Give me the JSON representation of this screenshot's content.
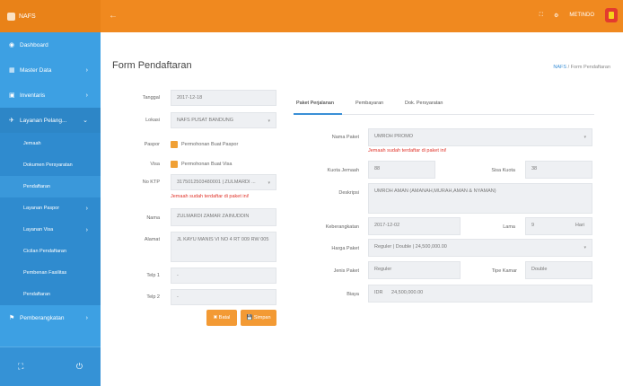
{
  "app": {
    "name": "NAFS"
  },
  "topbar": {
    "user": "METINDO"
  },
  "sidebar": {
    "items": [
      {
        "label": "Dashboard"
      },
      {
        "label": "Master Data"
      },
      {
        "label": "Inventaris"
      },
      {
        "label": "Layanan Pelang..."
      }
    ],
    "subitems": [
      {
        "label": "Jemaah"
      },
      {
        "label": "Dokumen Persyaratan"
      },
      {
        "label": "Pendaftaran"
      },
      {
        "label": "Layanan Paspor"
      },
      {
        "label": "Layanan Visa"
      },
      {
        "label": "Cicilan Pendaftaran"
      },
      {
        "label": "Pembenan Fasilitas"
      },
      {
        "label": "Pendaftaran"
      }
    ],
    "bottom_item": {
      "label": "Pemberangkatan"
    }
  },
  "page": {
    "title": "Form Pendaftaran",
    "breadcrumb": {
      "home": "NAFS",
      "sep": "/",
      "current": "Form Pendaftaran"
    }
  },
  "form": {
    "tanggal": {
      "label": "Tanggal",
      "value": "2017-12-18"
    },
    "lokasi": {
      "label": "Lokasi",
      "value": "NAFS PUSAT BANDUNG"
    },
    "paspor": {
      "label": "Paspor",
      "option": "Permohonan Buat Paspor"
    },
    "visa": {
      "label": "Visa",
      "option": "Permohonan Buat Visa"
    },
    "no_ktp": {
      "label": "No KTP",
      "value": "3175012503480001 | ZULMARDI ..."
    },
    "ktp_error": "Jemaah sudah terdaftar di paket ini!",
    "nama": {
      "label": "Nama",
      "value": "ZULMARDI ZAMAR ZAINUDDIN"
    },
    "alamat": {
      "label": "Alamat",
      "value": "JL KAYU MANIS VI NO 4 RT 009 RW 005"
    },
    "telp1": {
      "label": "Telp 1",
      "value": "-"
    },
    "telp2": {
      "label": "Telp 2",
      "value": "-"
    },
    "btn_batal": "✖ Batal",
    "btn_simpan": "💾 Simpan"
  },
  "tabs": [
    {
      "label": "Paket Perjalanan"
    },
    {
      "label": "Pembayaran"
    },
    {
      "label": "Dok. Persyaratan"
    }
  ],
  "paket": {
    "nama_paket": {
      "label": "Nama Paket",
      "value": "UMROH PROMO"
    },
    "paket_error": "Jemaah sudah terdaftar di paket ini!",
    "kuota_jemaah": {
      "label": "Kuota Jemaah",
      "value": "88"
    },
    "sisa_kuota": {
      "label": "Sisa Kuota",
      "value": "38"
    },
    "deskripsi": {
      "label": "Deskripsi",
      "value": "UMROH AMAN (AMANAH,MURAH,AMAN & NYAMAN)"
    },
    "keberangkatan": {
      "label": "Keberangkatan",
      "value": "2017-12-02"
    },
    "lama": {
      "label": "Lama",
      "value": "9",
      "unit": "Hari"
    },
    "harga_paket": {
      "label": "Harga Paket",
      "value": "Reguler | Double | 24,500,000.00"
    },
    "jenis_paket": {
      "label": "Jenis Paket",
      "value": "Reguler"
    },
    "tipe_kamar": {
      "label": "Tipe Kamar",
      "value": "Double"
    },
    "biaya": {
      "label": "Biaya",
      "currency": "IDR",
      "value": "24,500,000.00"
    }
  },
  "colors": {
    "topbar": "#f0891f",
    "sidebar": "#3da0e3",
    "accent": "#f39a34",
    "error": "#e0342a"
  }
}
